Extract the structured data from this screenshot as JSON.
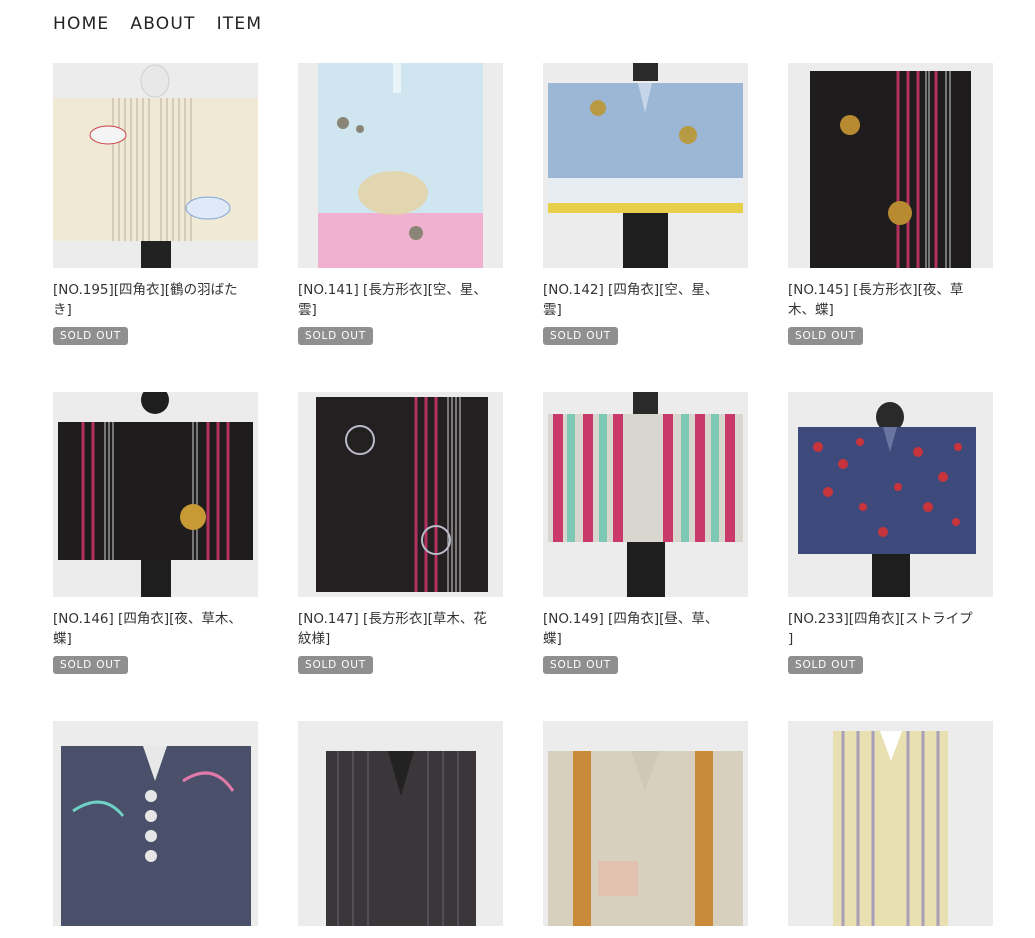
{
  "nav": {
    "home": "HOME",
    "about": "ABOUT",
    "item": "ITEM"
  },
  "products": [
    {
      "title": "[NO.195][四角衣][鶴の羽ばたき]",
      "badge": "SOLD OUT"
    },
    {
      "title": "[NO.141] [長方形衣][空、星、雲]",
      "badge": "SOLD OUT"
    },
    {
      "title": "[NO.142] [四角衣][空、星、雲]",
      "badge": "SOLD OUT"
    },
    {
      "title": "[NO.145] [長方形衣][夜、草木、蝶]",
      "badge": "SOLD OUT"
    },
    {
      "title": "[NO.146] [四角衣][夜、草木、蝶]",
      "badge": "SOLD OUT"
    },
    {
      "title": "[NO.147] [長方形衣][草木、花紋様]",
      "badge": "SOLD OUT"
    },
    {
      "title": "[NO.149] [四角衣][昼、草、蝶]",
      "badge": "SOLD OUT"
    },
    {
      "title": "[NO.233][四角衣][ストライプ ]",
      "badge": "SOLD OUT"
    },
    {
      "title": "",
      "badge": ""
    },
    {
      "title": "",
      "badge": ""
    },
    {
      "title": "",
      "badge": ""
    },
    {
      "title": "",
      "badge": ""
    }
  ],
  "garment_colors": [
    "#efe9d6",
    "#cfe6f1",
    "#9cb6d6",
    "#1f1c1e",
    "#1f1c1e",
    "#242022",
    "#c93a6a",
    "#3e4a7c",
    "#4a4f6a",
    "#3a363a",
    "#d8d0bf",
    "#e8e0b0"
  ]
}
